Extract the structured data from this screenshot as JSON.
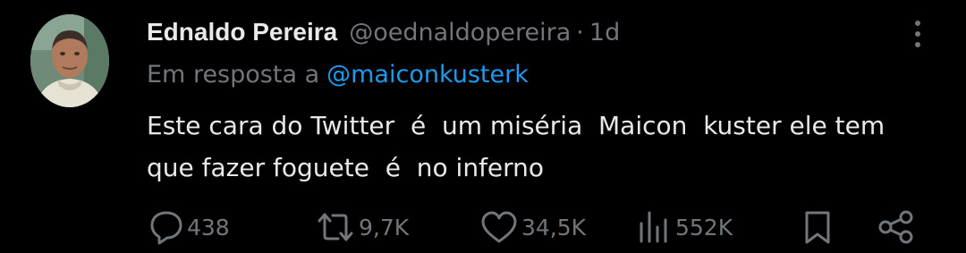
{
  "tweet": {
    "author": {
      "name": "Ednaldo Pereira",
      "handle": "@oednaldopereira",
      "separator": "·",
      "time": "1d"
    },
    "reply_to": {
      "prefix": "Em resposta a",
      "mention": "@maiconkusterk"
    },
    "text": "Este cara do Twitter  é  um miséria  Maicon  kuster ele tem\nque fazer foguete  é  no inferno",
    "actions": {
      "replies": "438",
      "reposts": "9,7K",
      "likes": "34,5K",
      "views": "552K"
    }
  },
  "icons": [
    "more-vertical-icon",
    "reply-icon",
    "repost-icon",
    "like-icon",
    "views-icon",
    "bookmark-icon",
    "share-icon"
  ],
  "colors": {
    "background": "#000000",
    "primary_text": "#e7e9ea",
    "secondary_text": "#71767b",
    "link": "#1d9bf0"
  }
}
